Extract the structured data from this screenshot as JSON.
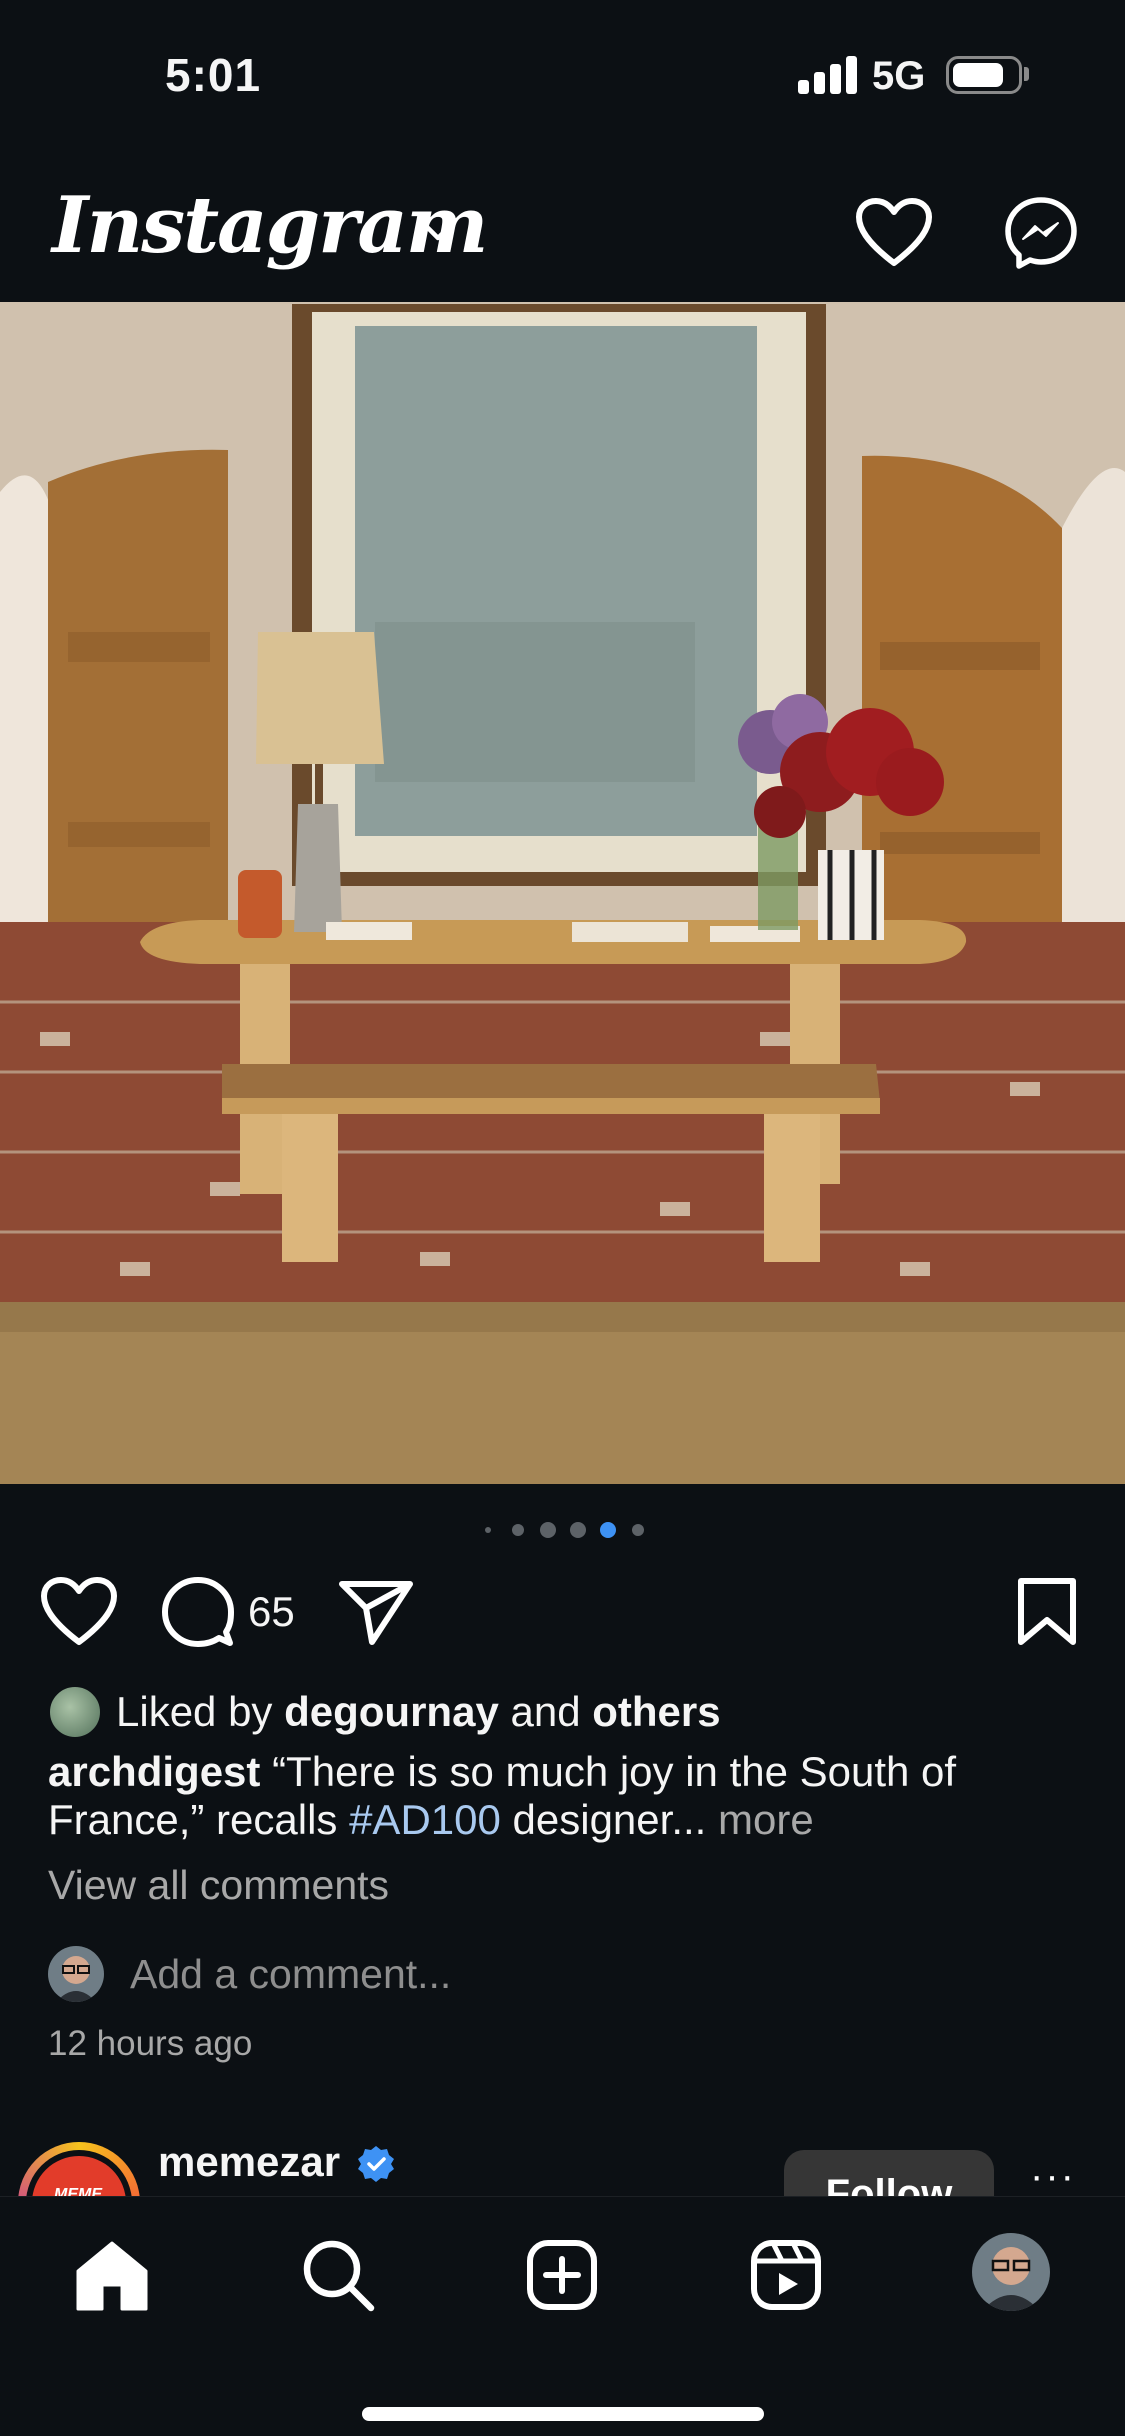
{
  "status_bar": {
    "time": "5:01",
    "network": "5G",
    "battery_level": 0.8
  },
  "header": {
    "logo_text": "Instagram",
    "icons": [
      "chevron-down-icon",
      "heart-icon",
      "messenger-icon"
    ]
  },
  "post": {
    "image_icon": "photo",
    "carousel": {
      "count": 6,
      "active_index": 4
    },
    "comment_count": "65",
    "likes": {
      "prefix": "Liked by ",
      "user": "degournay",
      "middle": " and ",
      "others": "others"
    },
    "caption": {
      "username": "archdigest",
      "text_before": " “There is so much joy in the South of France,” recalls ",
      "hashtag": "#AD100",
      "text_after": " designer... ",
      "more": "more"
    },
    "view_all_comments": "View all comments",
    "add_comment_placeholder": "Add a comment...",
    "timestamp": "12 hours ago"
  },
  "next_post": {
    "username": "memezar",
    "avatar_text": "MEME",
    "follow_label": "Follow",
    "more_label": "···"
  },
  "tab_bar": {
    "items": [
      "home-icon",
      "search-icon",
      "create-icon",
      "reels-icon",
      "profile-avatar"
    ],
    "active": "home"
  },
  "colors": {
    "background": "#0c1014",
    "accent": "#3e92f4",
    "hashtag": "#a9c9ef",
    "secondary_text": "#a8a8a8"
  }
}
